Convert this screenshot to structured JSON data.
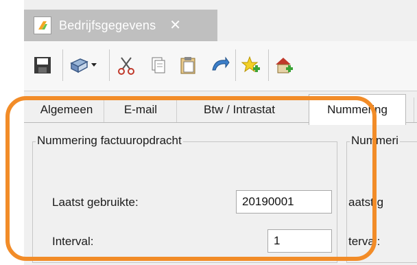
{
  "window": {
    "title": "Bedrijfsgegevens",
    "close_glyph": "✕"
  },
  "toolbar": {
    "buttons": [
      {
        "name": "save-icon"
      },
      {
        "name": "print-dropdown-icon"
      },
      {
        "name": "cut-icon"
      },
      {
        "name": "copy-icon"
      },
      {
        "name": "paste-icon"
      },
      {
        "name": "undo-icon"
      },
      {
        "name": "favorite-add-icon"
      },
      {
        "name": "home-add-icon"
      }
    ]
  },
  "tabs": [
    {
      "label": "Algemeen",
      "active": false
    },
    {
      "label": "E-mail",
      "active": false
    },
    {
      "label": "Btw / Intrastat",
      "active": false
    },
    {
      "label": "Nummering",
      "active": true
    }
  ],
  "groups": {
    "factuuropdracht": {
      "title": "Nummering factuuropdracht",
      "last_used_label": "Laatst gebruikte:",
      "last_used_value": "20190001",
      "interval_label": "Interval:",
      "interval_value": "1"
    },
    "second": {
      "title": "Nummeri",
      "last_used_label": "aatst g",
      "interval_label": "terval:"
    }
  },
  "colors": {
    "highlight": "#f28c28",
    "tab_inactive": "#bfbfbf"
  }
}
